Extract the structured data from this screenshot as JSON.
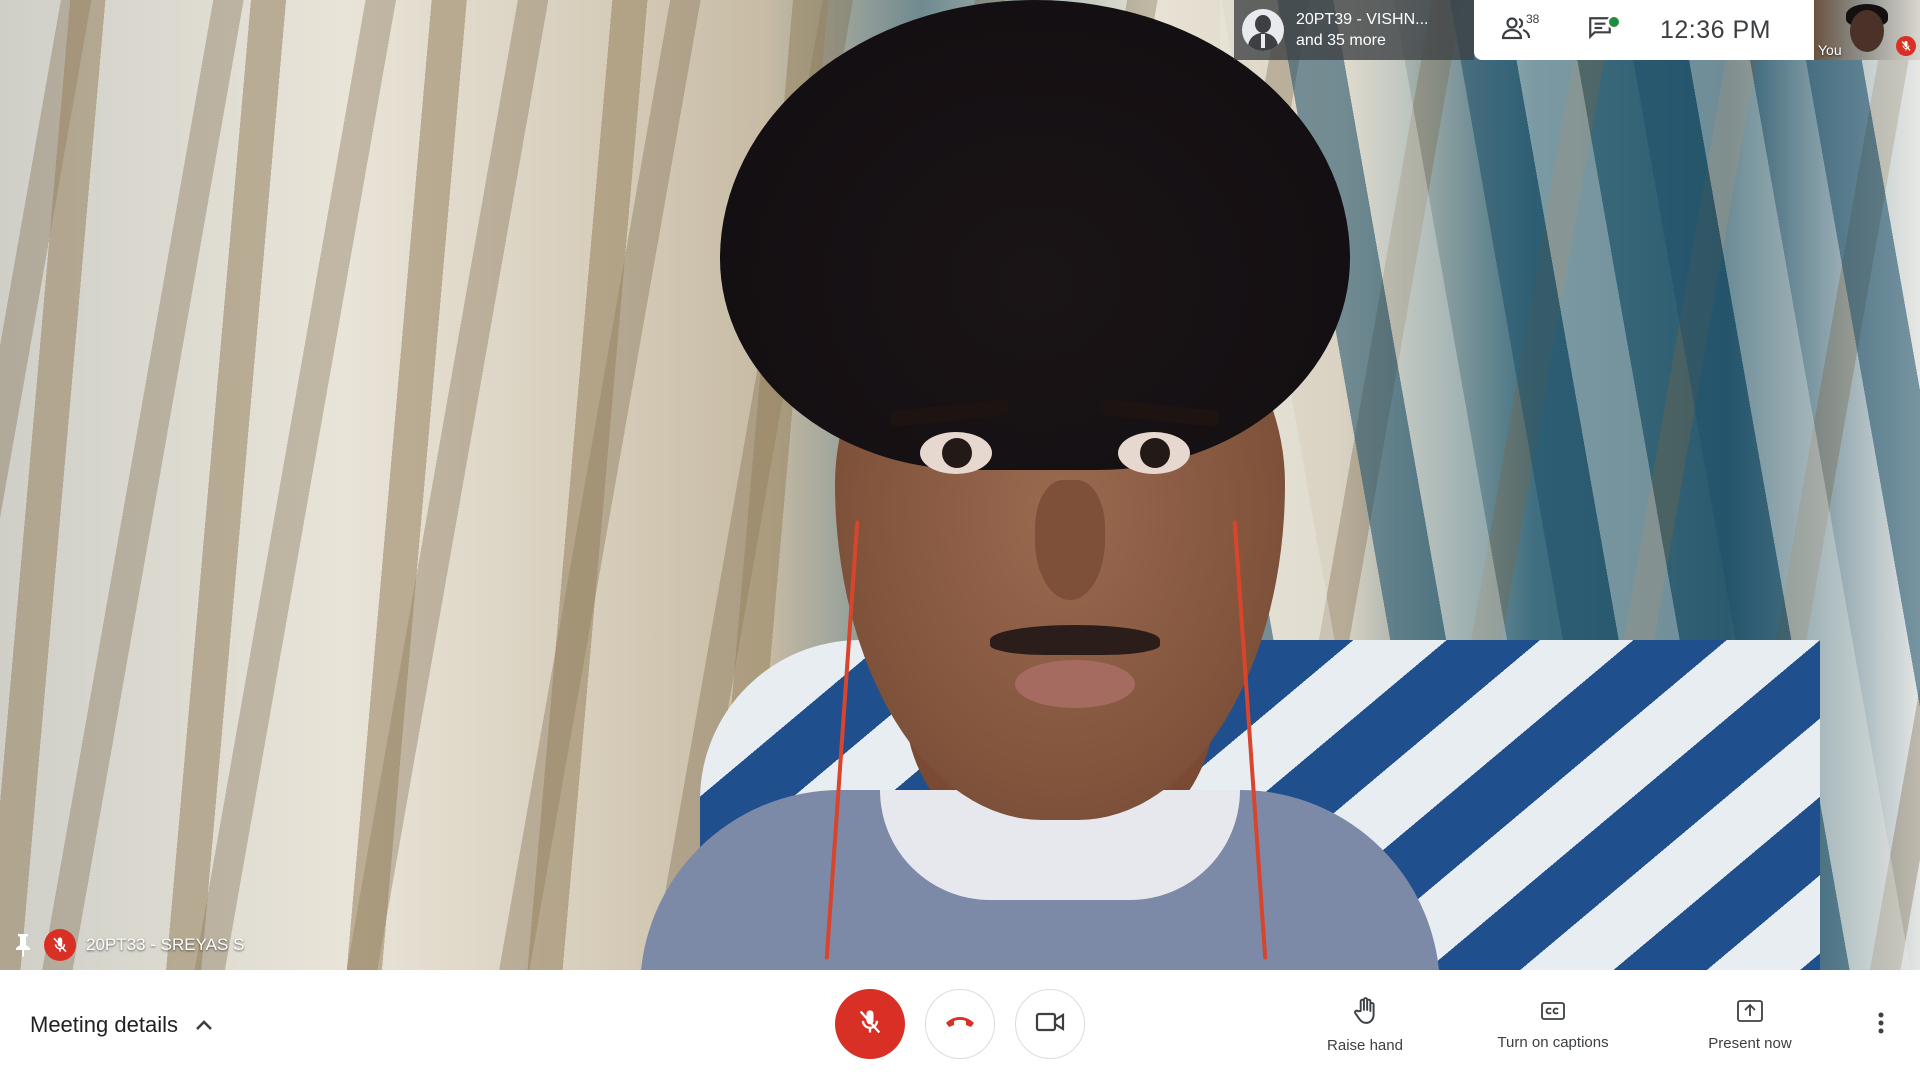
{
  "video": {
    "speaker_name": "20PT33 - SREYAS S"
  },
  "top_overlay": {
    "participant_chip_line1": "20PT39 - VISHN...",
    "participant_chip_line2": "and 35 more",
    "people_count": "38",
    "clock": "12:36  PM",
    "self_label": "You"
  },
  "bottom_bar": {
    "meeting_details_label": "Meeting details",
    "raise_hand_label": "Raise hand",
    "captions_label": "Turn on captions",
    "present_label": "Present now"
  },
  "colors": {
    "mute_red": "#d93025",
    "chat_dot_green": "#1e8e3e",
    "icon_grey": "#3c4043"
  },
  "icons": [
    "pin-icon",
    "mic-off-icon",
    "people-icon",
    "chat-icon",
    "chevron-up-icon",
    "hangup-icon",
    "camera-icon",
    "raise-hand-icon",
    "captions-icon",
    "present-icon",
    "more-vert-icon"
  ]
}
